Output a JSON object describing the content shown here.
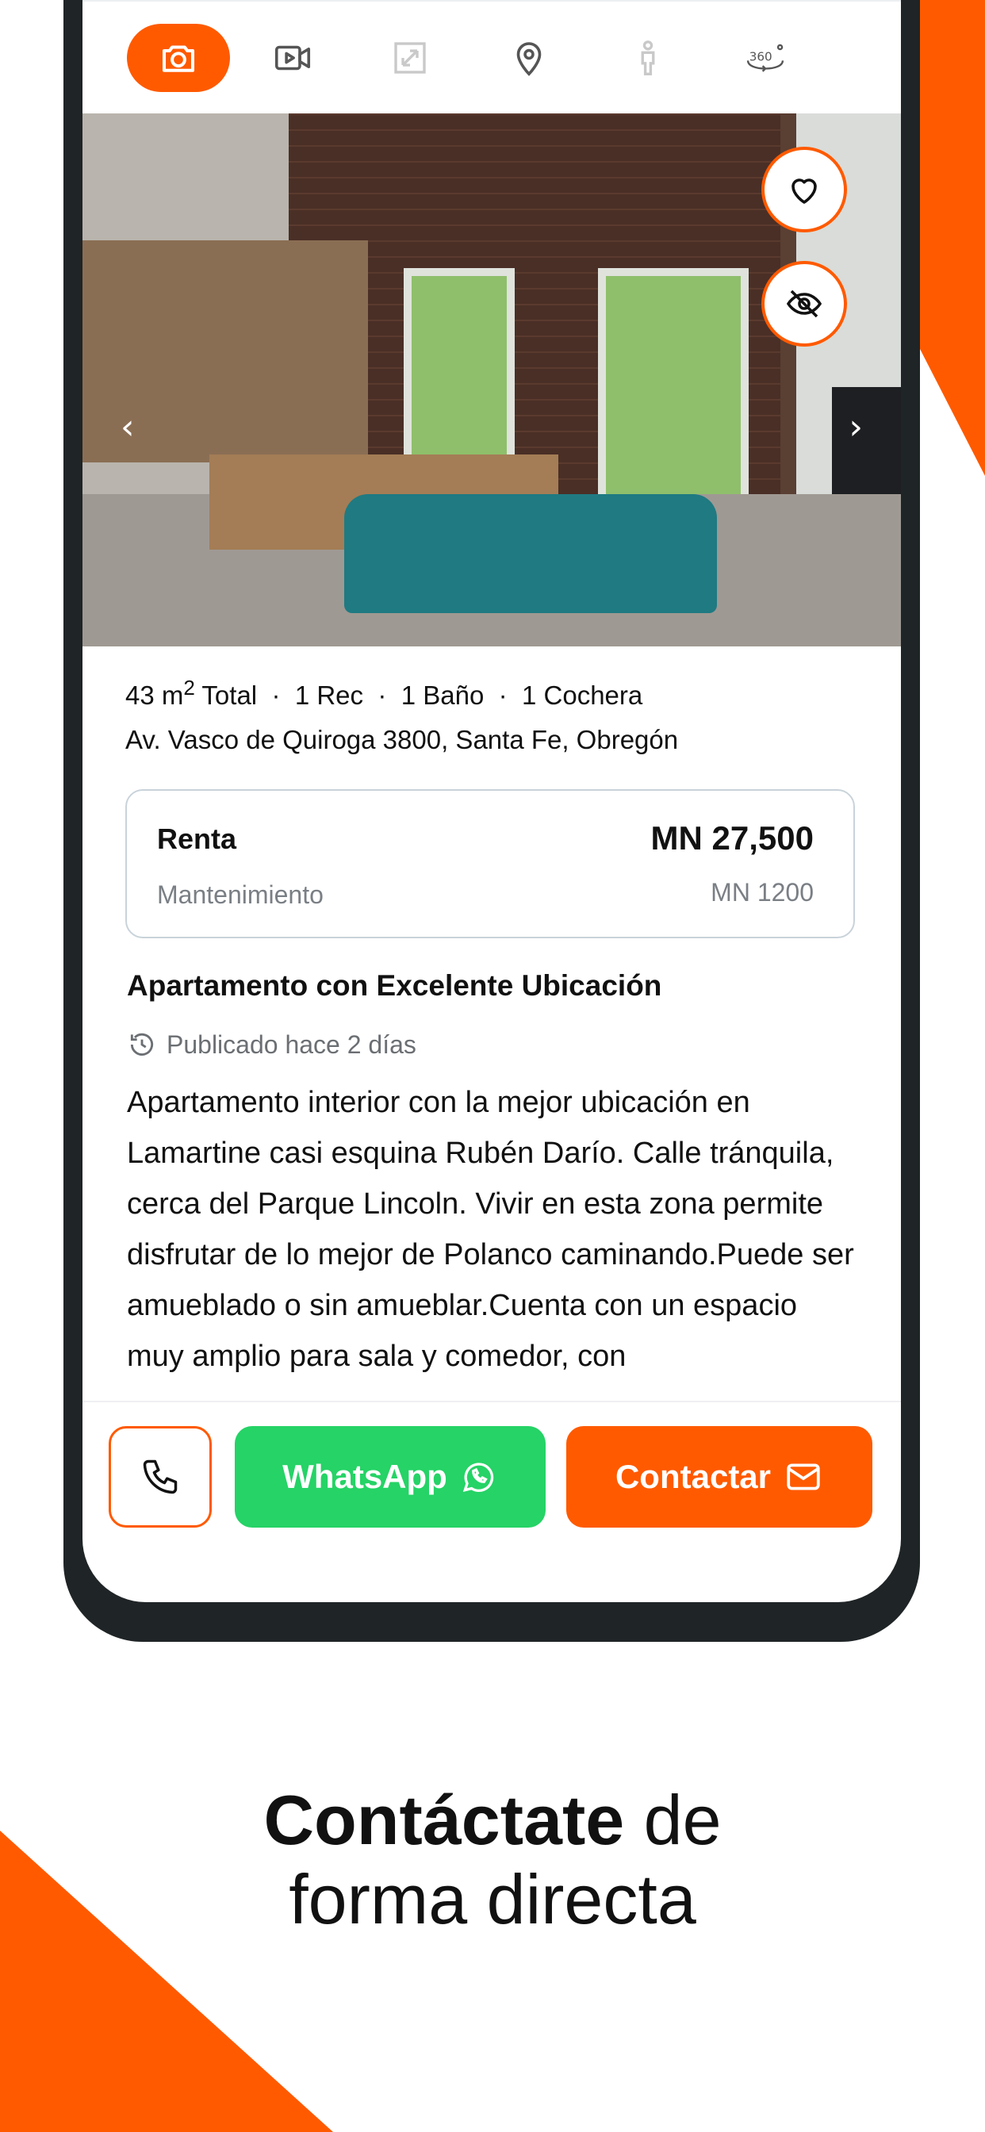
{
  "colors": {
    "accent": "#ff5a00",
    "whatsapp": "#25d366",
    "text": "#111111",
    "muted": "#7a7f85"
  },
  "media_tabs": [
    {
      "name": "photos",
      "icon": "camera-icon",
      "active": true
    },
    {
      "name": "video",
      "icon": "video-icon",
      "active": false
    },
    {
      "name": "plans",
      "icon": "expand-icon",
      "active": false
    },
    {
      "name": "map",
      "icon": "location-pin-icon",
      "active": false
    },
    {
      "name": "street-view",
      "icon": "person-icon",
      "active": false
    },
    {
      "name": "tour-360",
      "icon": "360-icon",
      "active": false
    }
  ],
  "photo": {
    "favorite_icon": "heart-icon",
    "hide_icon": "eye-off-icon",
    "prev_icon": "chevron-left-icon",
    "next_icon": "chevron-right-icon"
  },
  "listing": {
    "area_value": "43 m",
    "area_sup": "2",
    "area_label": " Total",
    "rooms": "1 Rec",
    "baths": "1 Baño",
    "parking": "1 Cochera",
    "separator": "·",
    "address": "Av. Vasco de Quiroga 3800, Santa Fe, Obregón",
    "title": "Apartamento con Excelente Ubicación",
    "published": "Publicado hace 2 días",
    "description": "Apartamento interior con la mejor ubicación en Lamartine casi esquina Rubén Darío. Calle tránquila, cerca del Parque Lincoln. Vivir en esta zona permite disfrutar de lo mejor de Polanco caminando.Puede ser amueblado o sin amueblar.Cuenta con un espacio muy amplio para sala y comedor, con"
  },
  "price": {
    "label": "Renta",
    "value": "MN 27,500",
    "maintenance_label": "Mantenimiento",
    "maintenance_value": "MN 1200"
  },
  "actions": {
    "whatsapp_label": "WhatsApp",
    "contact_label": "Contactar"
  },
  "tagline": {
    "bold": "Contáctate",
    "rest": " de",
    "line2": "forma directa"
  }
}
